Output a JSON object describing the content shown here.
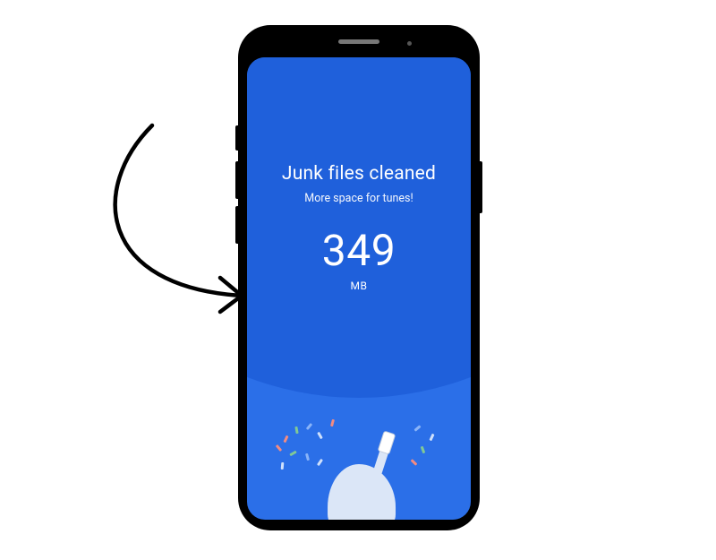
{
  "screen": {
    "title": "Junk files cleaned",
    "subtitle": "More space for tunes!",
    "amount": "349",
    "unit": "MB"
  },
  "colors": {
    "screen_bg": "#2b6fe8",
    "arc_bg": "#1f60db",
    "text": "#ffffff",
    "mascot": "#dbe6f7"
  }
}
